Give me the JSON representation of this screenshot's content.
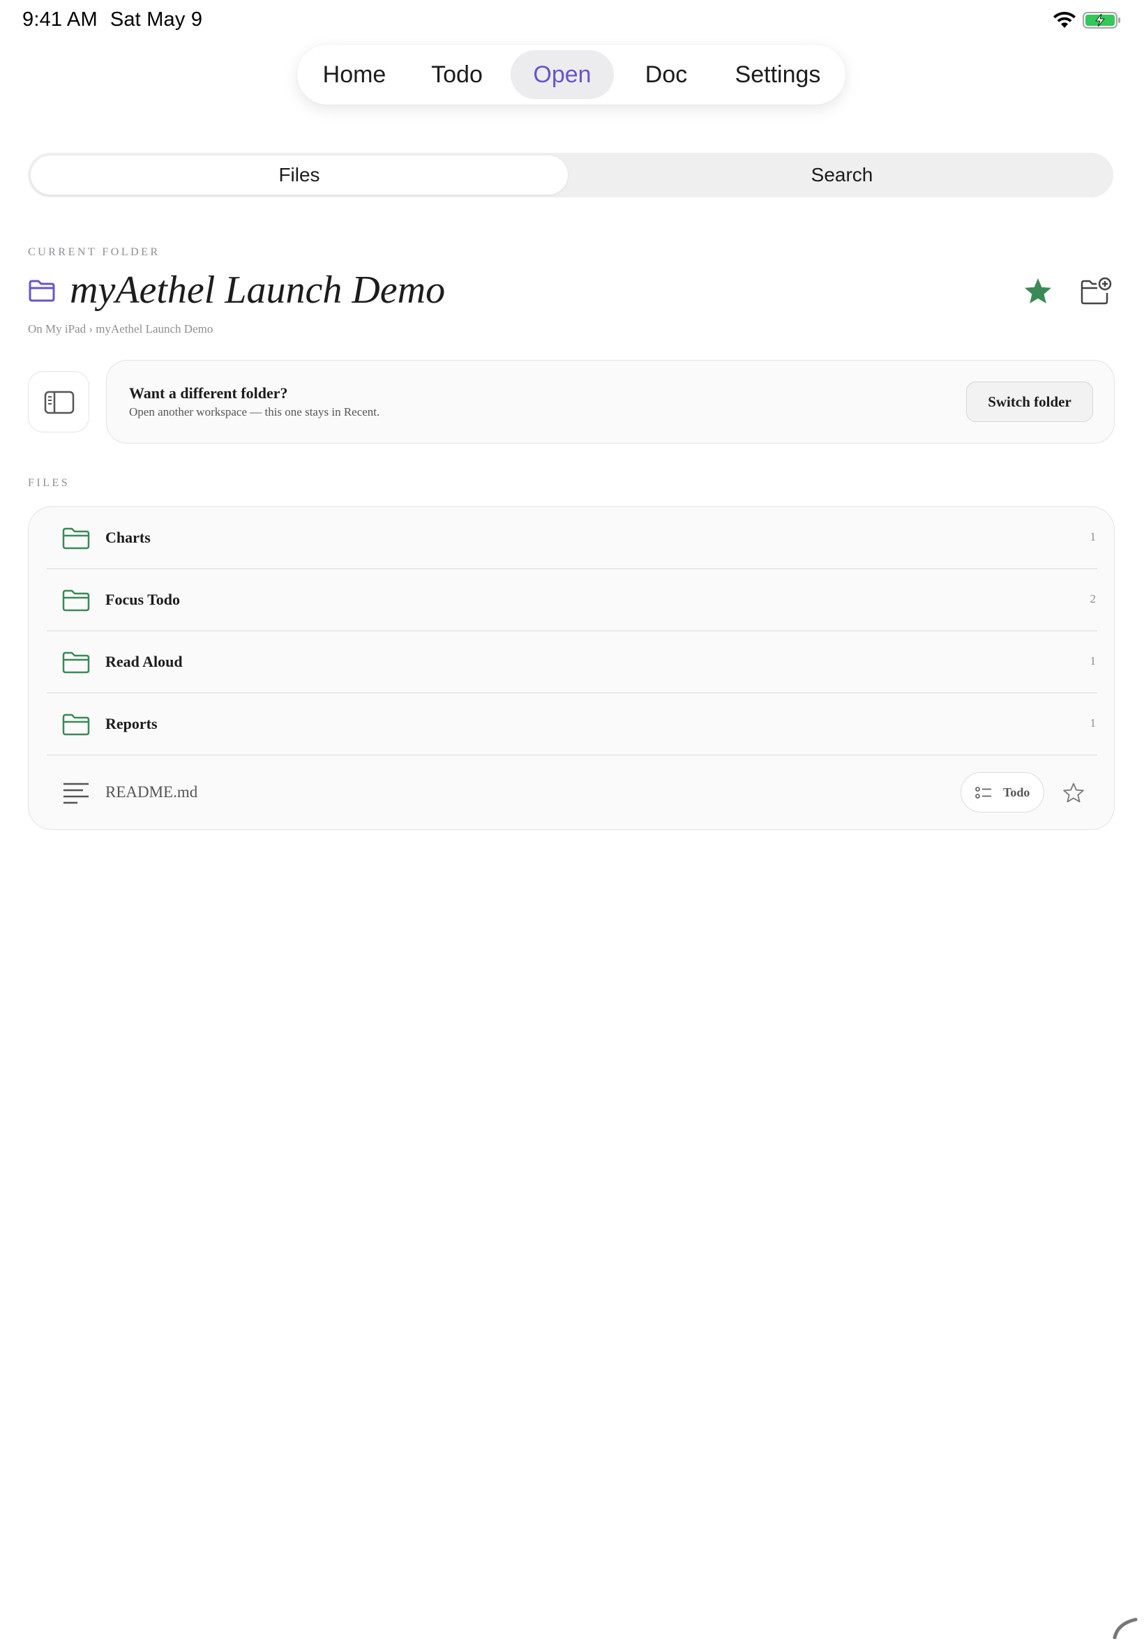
{
  "status_bar": {
    "time": "9:41 AM",
    "date": "Sat May 9",
    "icons": [
      "wifi-icon",
      "battery-charging-icon"
    ]
  },
  "top_tabs": [
    {
      "label": "Home",
      "active": false
    },
    {
      "label": "Todo",
      "active": false
    },
    {
      "label": "Open",
      "active": true
    },
    {
      "label": "Doc",
      "active": false
    },
    {
      "label": "Settings",
      "active": false
    }
  ],
  "segment": {
    "items": [
      "Files",
      "Search"
    ],
    "selected": "Files"
  },
  "current_folder": {
    "section_label": "CURRENT FOLDER",
    "title": "myAethel Launch Demo",
    "breadcrumb": "On My iPad › myAethel Launch Demo",
    "favorite": true
  },
  "switch_card": {
    "title": "Want a different folder?",
    "subtitle": "Open another workspace — this one stays in Recent.",
    "button": "Switch folder"
  },
  "files": {
    "section_label": "FILES",
    "folders": [
      {
        "name": "Charts",
        "count": "1"
      },
      {
        "name": "Focus Todo",
        "count": "2"
      },
      {
        "name": "Read Aloud",
        "count": "1"
      },
      {
        "name": "Reports",
        "count": "1"
      }
    ],
    "document": {
      "name": "README.md",
      "badge": "Todo",
      "favorite": false
    }
  },
  "colors": {
    "accent": "#6a54c6",
    "green": "#3a8a57",
    "border": "#e3e3e6",
    "muted": "#8e8e93"
  }
}
